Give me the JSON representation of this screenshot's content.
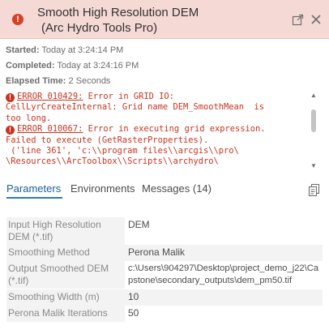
{
  "header": {
    "title": "Smooth High Resolution DEM",
    "subtitle": "(Arc Hydro Tools Pro)",
    "status_icon": "error-icon",
    "accent_color": "#f5d9d4"
  },
  "times": {
    "started_label": "Started:",
    "started_value": "Today at 3:24:14 PM",
    "completed_label": "Completed:",
    "completed_value": "Today at 3:24:16 PM",
    "elapsed_label": "Elapsed Time:",
    "elapsed_value": "2 Seconds"
  },
  "messages": {
    "error1_code": "ERROR 010429:",
    "error1_text": " Error in GRID IO:",
    "error1_line2": "CellLyrCreateInternal: Grid name DEM_SmoothMean  is",
    "error1_line3": "too long.",
    "error2_code": "ERROR 010067:",
    "error2_text": " Error in executing grid expression.",
    "error2_line2": "Failed to execute (GetRasterProperties).",
    "error2_line3": " ('line 361', 'c:\\\\program files\\\\arcgis\\\\pro\\",
    "error2_line4": "\\Resources\\\\ArcToolbox\\\\Scripts\\\\archydro\\",
    "error_color": "#c8331f"
  },
  "tabs": {
    "parameters": "Parameters",
    "environments": "Environments",
    "messages": "Messages (14)"
  },
  "parameters": [
    {
      "label": "Input High Resolution DEM (*.tif)",
      "value": "DEM"
    },
    {
      "label": "Smoothing Method",
      "value": "Perona Malik"
    },
    {
      "label": "Output Smoothed DEM (*.tif)",
      "value": "c:\\Users\\904297\\Desktop\\project_demo_j22\\Capstone\\secondary_outputs\\dem_pm50.tif"
    },
    {
      "label": "Smoothing Width (m)",
      "value": "10"
    },
    {
      "label": "Perona Malik Iterations",
      "value": "50"
    }
  ]
}
